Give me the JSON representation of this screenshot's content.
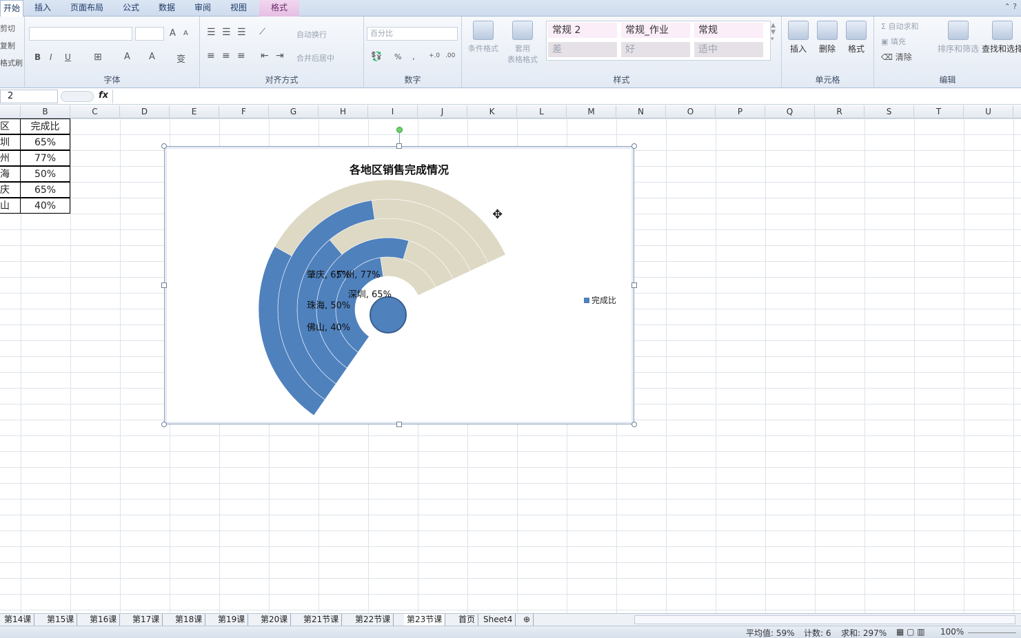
{
  "tabs": [
    "开始",
    "插入",
    "页面布局",
    "公式",
    "数据",
    "审阅",
    "视图",
    "格式"
  ],
  "clipboard": {
    "cut": "剪切",
    "copy": "复制",
    "painter": "格式刷"
  },
  "font_group": {
    "label": "字体",
    "bold": "B",
    "italic": "I",
    "underline": "U",
    "grow": "A",
    "shrink": "A",
    "fill": "A",
    "color": "A",
    "wen": "变"
  },
  "align_group": {
    "label": "对齐方式",
    "wrap": "自动换行",
    "merge": "合并后居中"
  },
  "number_group": {
    "label": "数字",
    "format": "百分比",
    "percent": "%",
    "comma": ",",
    "inc": "+.0",
    "dec": ".00"
  },
  "styles_group": {
    "label": "样式",
    "cond": "条件格式",
    "table1": "套用",
    "table2": "表格格式",
    "cells": [
      "常规 2",
      "常规_作业",
      "常规",
      "差",
      "好",
      "适中"
    ]
  },
  "cells_group": {
    "label": "单元格",
    "insert": "插入",
    "delete": "删除",
    "format": "格式"
  },
  "edit_group": {
    "label": "编辑",
    "autosum": "自动求和",
    "fill": "填充",
    "clear": "清除",
    "sort": "排序和筛选",
    "find": "查找和选择"
  },
  "formula_bar": {
    "name_box": "2",
    "fx": "fx",
    "formula": ""
  },
  "columns": [
    "B",
    "C",
    "D",
    "E",
    "F",
    "G",
    "H",
    "I",
    "J",
    "K",
    "L",
    "M",
    "N",
    "O",
    "P",
    "Q",
    "R",
    "S",
    "T",
    "U"
  ],
  "table": {
    "header": [
      "区",
      "完成比"
    ],
    "rows": [
      [
        "圳",
        "65%"
      ],
      [
        "州",
        "77%"
      ],
      [
        "海",
        "50%"
      ],
      [
        "庆",
        "65%"
      ],
      [
        "山",
        "40%"
      ]
    ]
  },
  "chart_data": {
    "type": "doughnut",
    "title": "各地区销售完成情况",
    "categories": [
      "深圳",
      "广州",
      "珠海",
      "肇庆",
      "佛山"
    ],
    "series": [
      {
        "name": "完成比",
        "values": [
          0.65,
          0.77,
          0.5,
          0.65,
          0.4
        ]
      }
    ],
    "data_labels": [
      "深圳, 65%",
      "广州, 77%",
      "珠海, 50%",
      "肇庆, 65%",
      "佛山, 40%"
    ],
    "legend_position": "right",
    "colors": {
      "value": "#4f81bd",
      "remainder": "#ddd9c4"
    }
  },
  "sheets": [
    "第14课",
    "第15课",
    "第16课",
    "第17课",
    "第18课",
    "第19课",
    "第20课",
    "第21节课",
    "第22节课",
    "第23节课",
    "首页",
    "Sheet4"
  ],
  "active_sheet": "第23节课",
  "status": {
    "avg": "平均值: 59%",
    "count": "计数: 6",
    "sum": "求和: 297%",
    "zoom": "100%"
  }
}
